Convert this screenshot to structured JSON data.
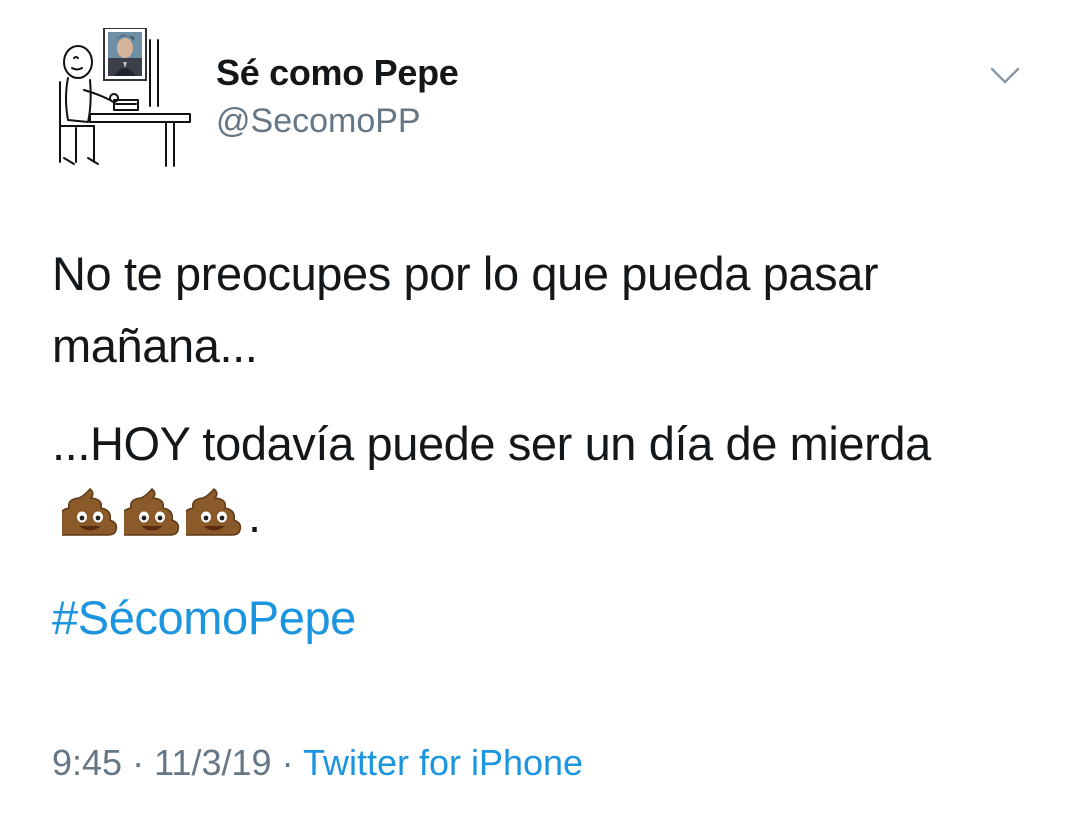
{
  "author": {
    "display_name": "Sé como Pepe",
    "handle": "@SecomoPP"
  },
  "tweet": {
    "paragraph1": "No te preocupes por lo que pueda pasar mañana...",
    "paragraph2_text": "...HOY todavía  puede ser un día de mierda",
    "paragraph2_trailing": ".",
    "emojis": [
      "pile-of-poo-icon",
      "pile-of-poo-icon",
      "pile-of-poo-icon"
    ],
    "hashtag": "#SécomoPepe"
  },
  "meta": {
    "time": "9:45",
    "separator": "·",
    "date": "11/3/19",
    "source": "Twitter for iPhone"
  },
  "colors": {
    "text": "#14171a",
    "secondary": "#657786",
    "link": "#1b95e0",
    "background": "#ffffff"
  }
}
